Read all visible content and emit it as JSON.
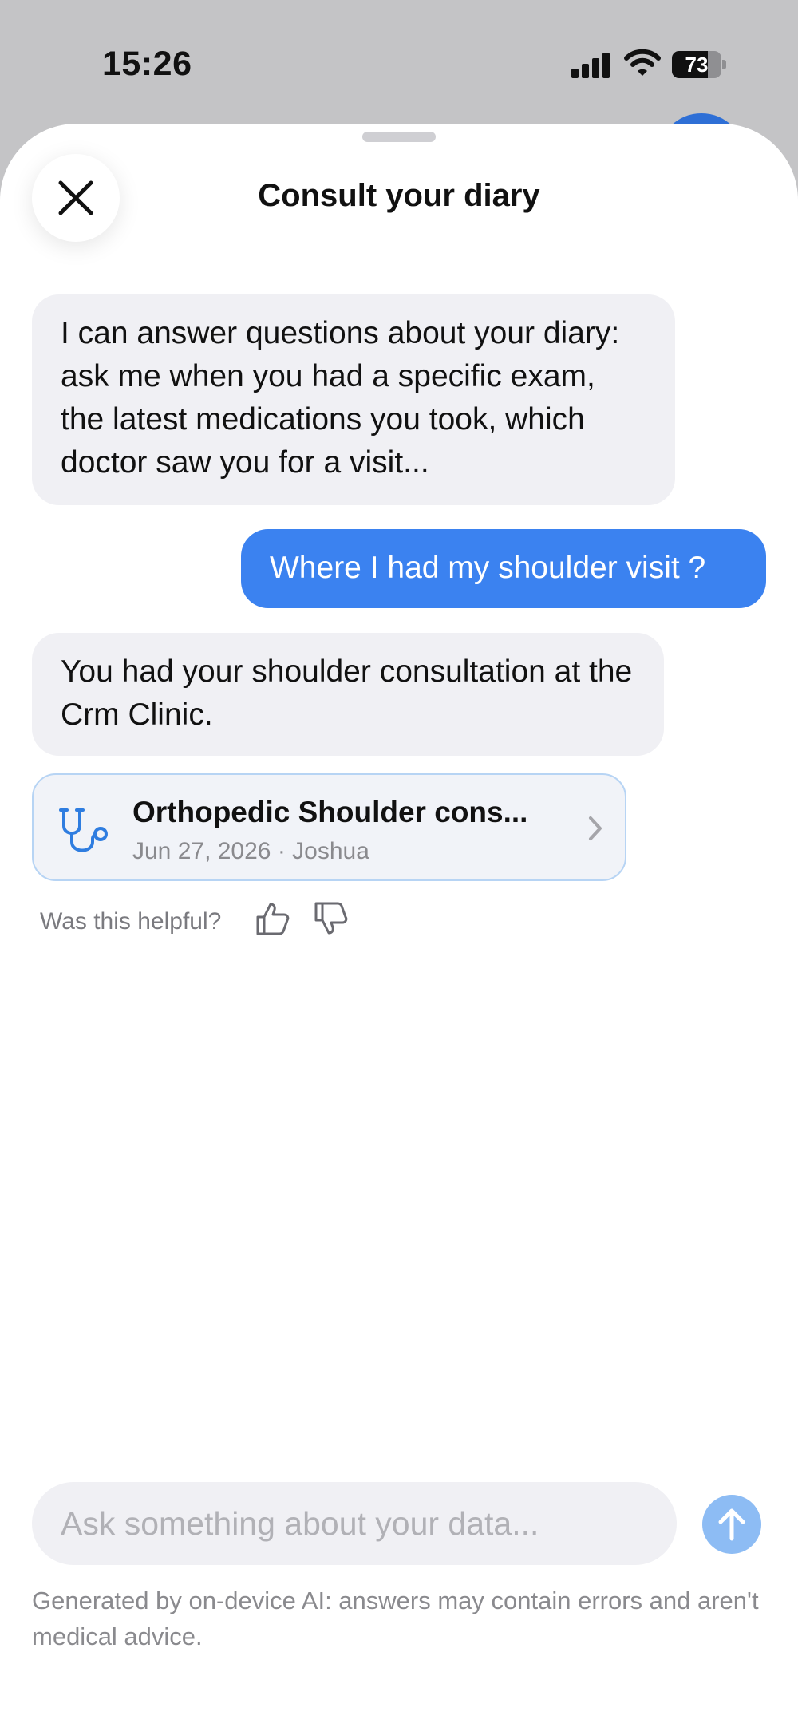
{
  "status_bar": {
    "time": "15:26",
    "battery_level": "73",
    "battery_fraction": 0.73
  },
  "sheet": {
    "title": "Consult your diary"
  },
  "chat": {
    "messages": [
      {
        "role": "assistant",
        "text": "I can answer questions about your diary: ask me when you had a specific exam, the latest medications you took, which doctor saw you for a visit..."
      },
      {
        "role": "user",
        "text": "Where I had my shoulder visit ?"
      },
      {
        "role": "assistant",
        "text": "You had your shoulder consultation at the Crm Clinic."
      }
    ],
    "source_card": {
      "title": "Orthopedic Shoulder cons...",
      "meta": "Jun 27, 2026 · Joshua",
      "icon": "stethoscope-icon"
    },
    "feedback": {
      "label": "Was this helpful?"
    }
  },
  "composer": {
    "placeholder": "Ask something about your data...",
    "value": ""
  },
  "disclaimer": "Generated by on-device AI: answers may contain errors and aren't medical advice.",
  "colors": {
    "accent": "#3b82f0",
    "send_button_disabled": "#8dbcf4",
    "bubble_assistant": "#f0f0f4",
    "card_border": "#b7d4f4",
    "stethoscope": "#2f7de0"
  }
}
